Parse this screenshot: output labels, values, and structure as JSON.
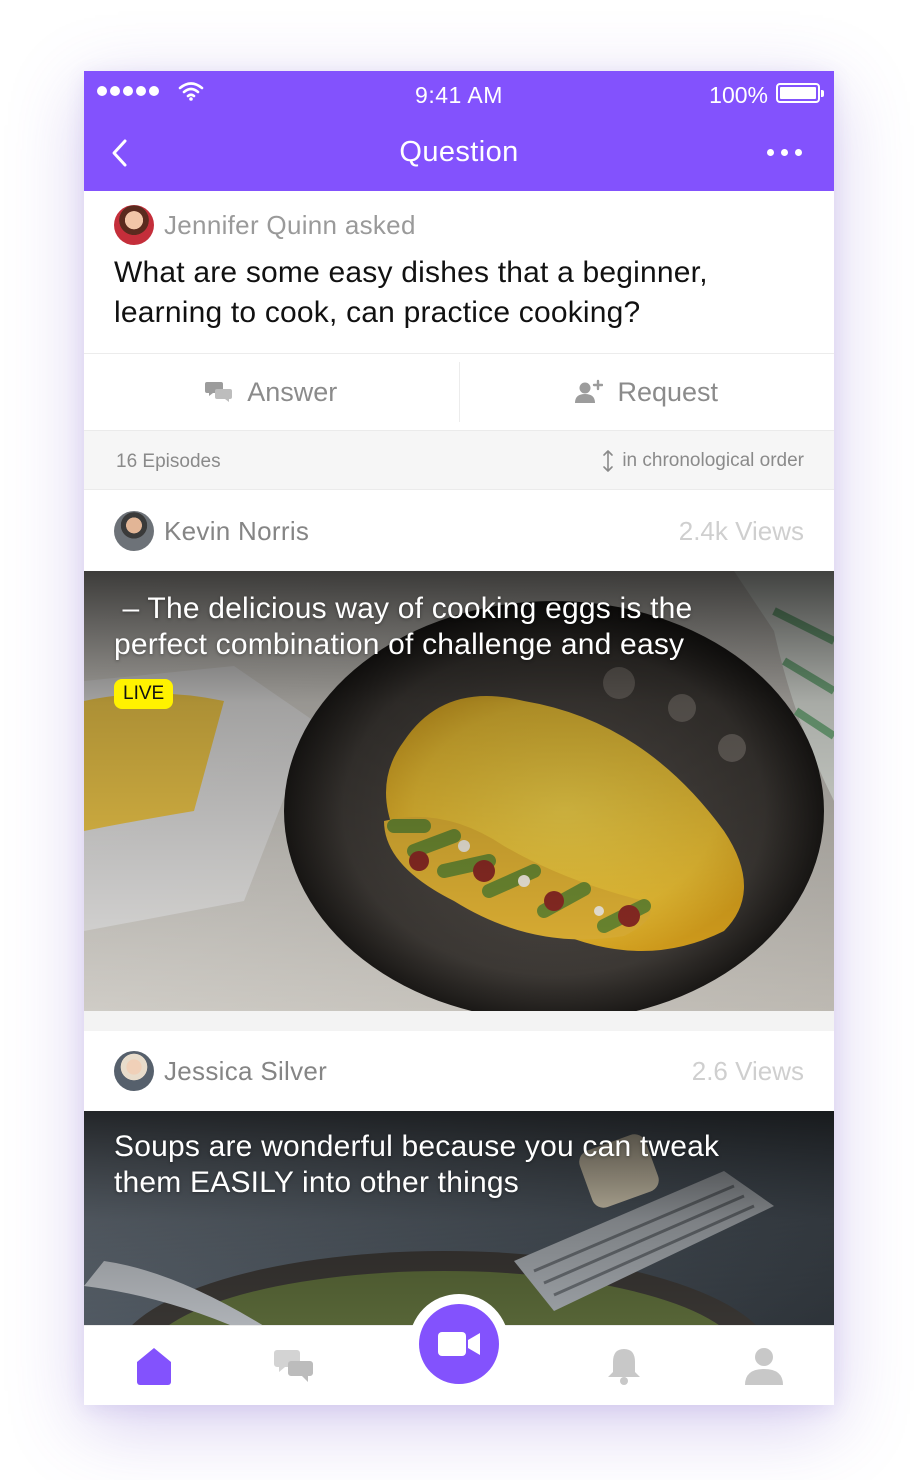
{
  "status_bar": {
    "time": "9:41 AM",
    "battery": "100%"
  },
  "nav": {
    "title": "Question"
  },
  "question": {
    "asker": "Jennifer Quinn asked",
    "text": "What are some easy dishes that a beginner, learning to cook, can practice cooking?"
  },
  "actions": {
    "answer": "Answer",
    "request": "Request"
  },
  "episodes": {
    "count": "16 Episodes",
    "order": "in chronological order"
  },
  "posts": [
    {
      "author": "Kevin Norris",
      "views": "2.4k Views",
      "caption": " – The delicious way of cooking eggs is the perfect combination of challenge and easy",
      "badge": "LIVE"
    },
    {
      "author": "Jessica Silver",
      "views": "2.6 Views",
      "caption": "Soups are wonderful because you can tweak them EASILY into other things"
    }
  ],
  "tab_bar": {
    "tabs": [
      "home-icon",
      "chat-icon",
      "video-camera-icon",
      "bell-icon",
      "profile-icon"
    ],
    "active": "home-icon"
  },
  "colors": {
    "accent": "#8352FD",
    "live_badge": "#FFF200"
  }
}
